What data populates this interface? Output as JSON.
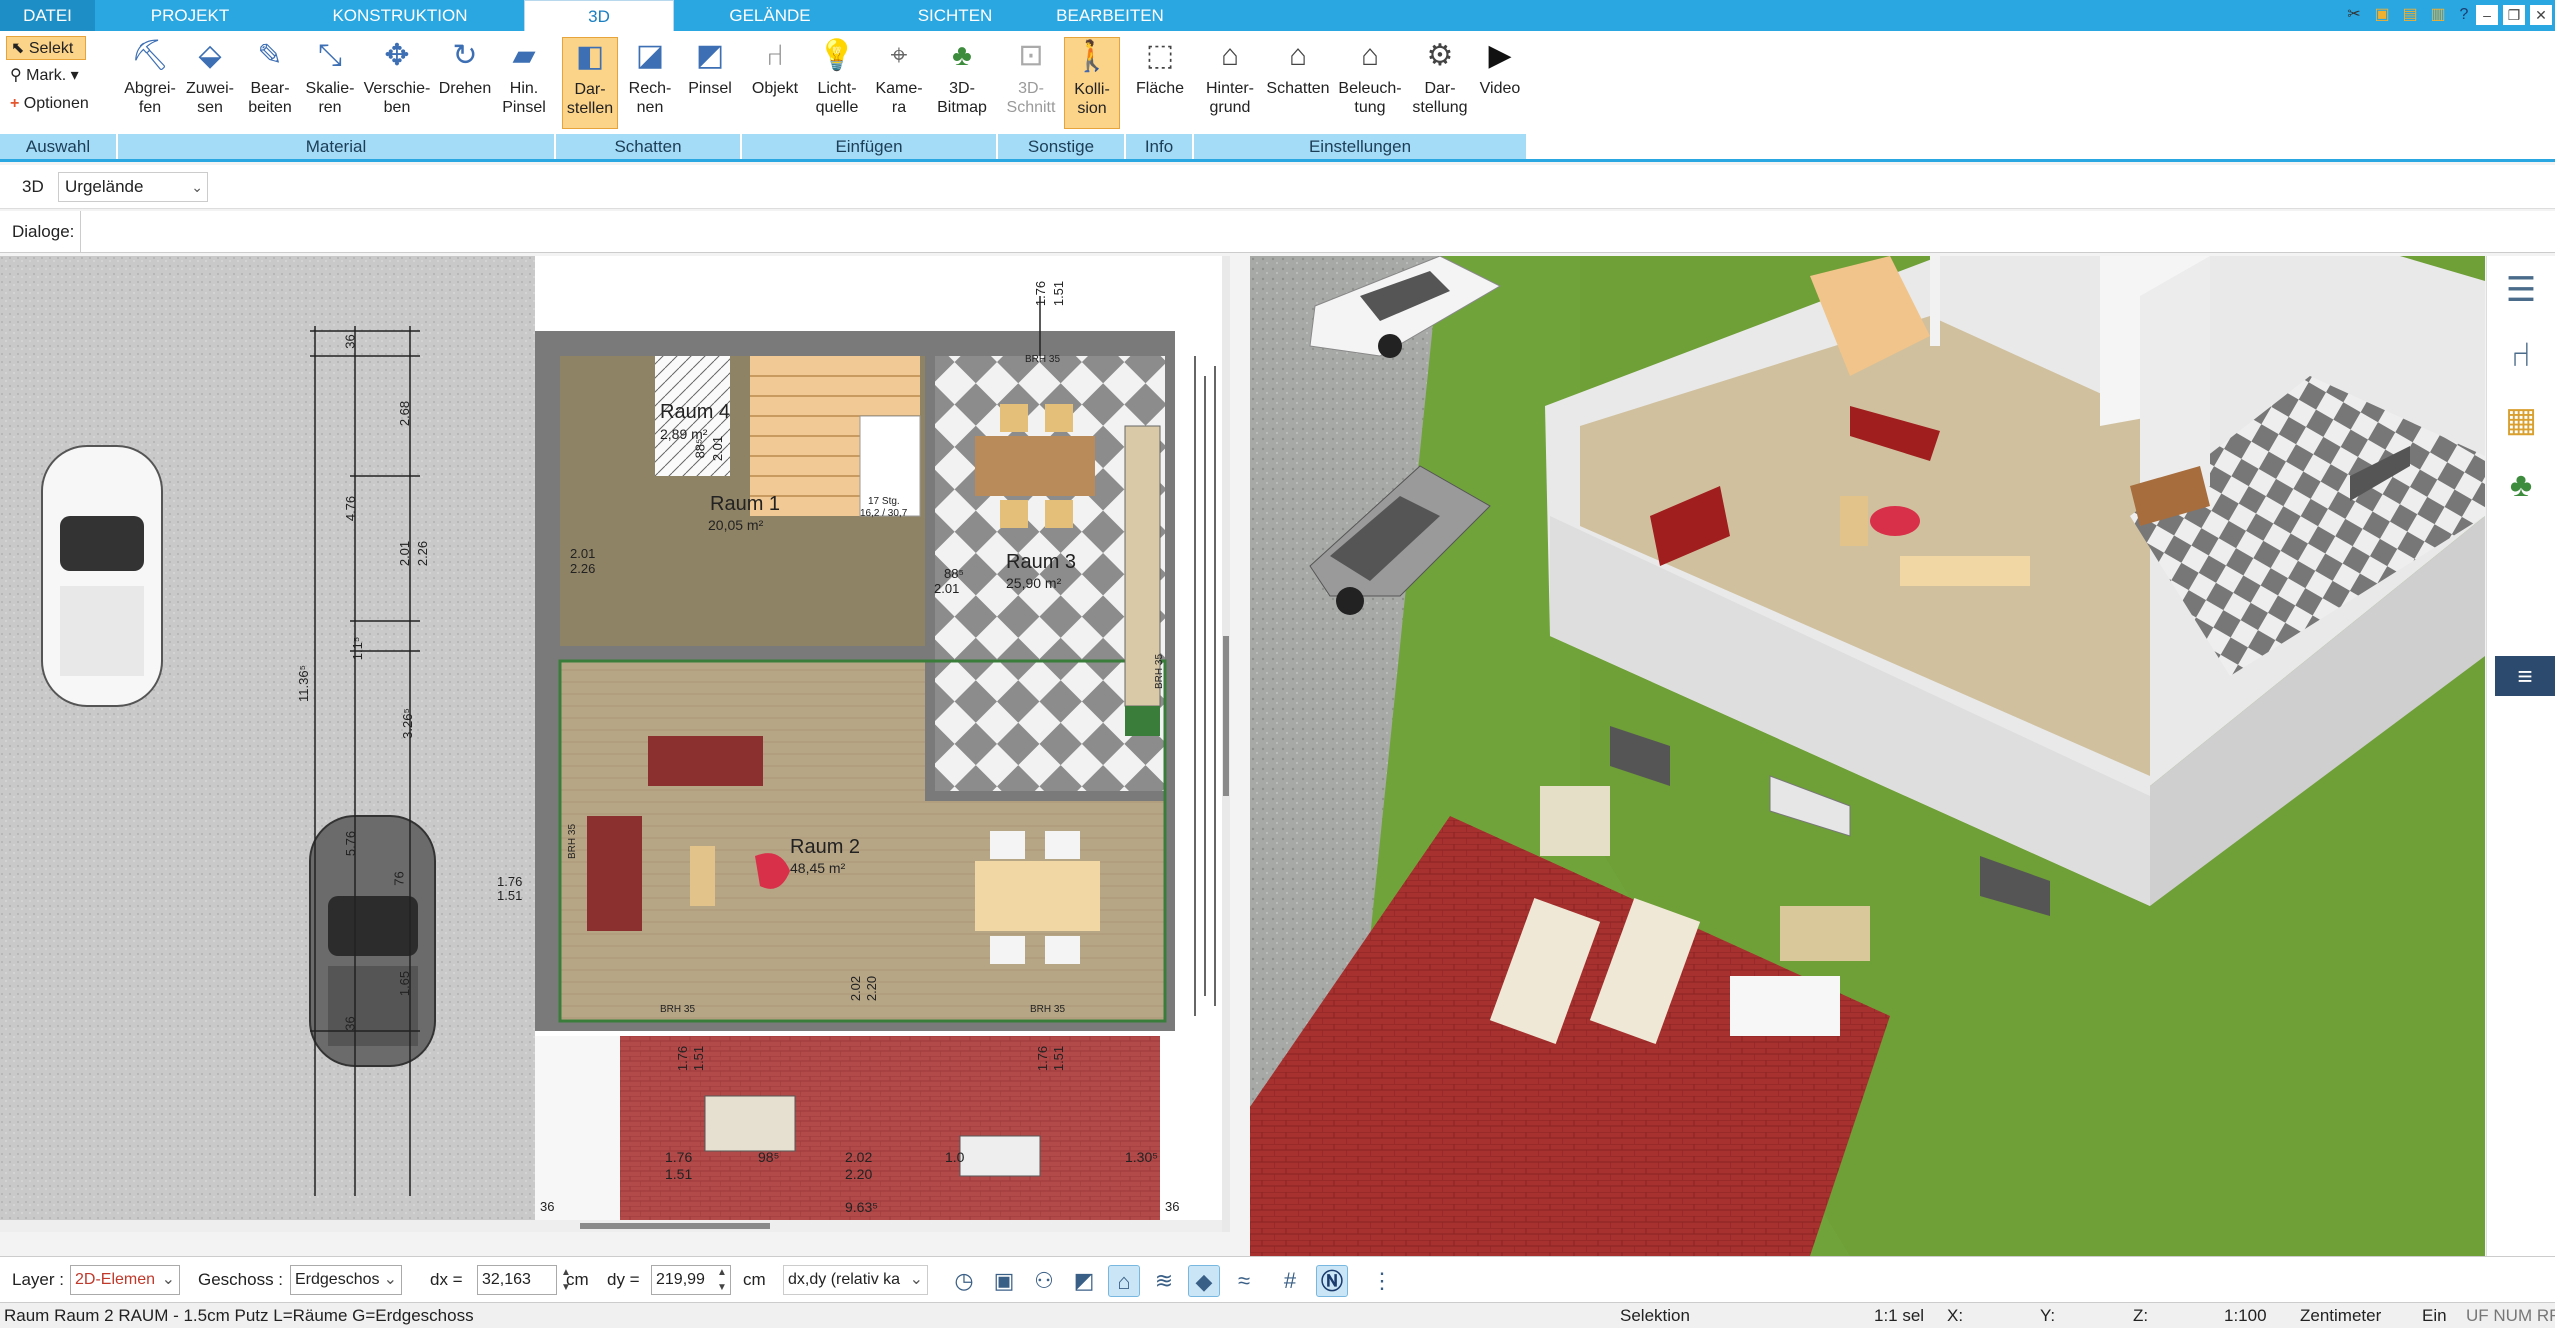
{
  "tabs": [
    "DATEI",
    "PROJEKT",
    "KONSTRUKTION",
    "3D",
    "GELÄNDE",
    "SICHTEN",
    "BEARBEITEN"
  ],
  "active_tab": "3D",
  "ribbon": {
    "auswahl": {
      "label": "Auswahl",
      "selekt": "Selekt",
      "mark": "Mark.",
      "optionen": "Optionen"
    },
    "material": {
      "label": "Material",
      "buttons": [
        "Abgrei-\nfen",
        "Zuwei-\nsen",
        "Bear-\nbeiten",
        "Skalie-\nren",
        "Verschie-\nben",
        "Drehen",
        "Hin.\nPinsel"
      ]
    },
    "schatten": {
      "label": "Schatten",
      "buttons": [
        "Dar-\nstellen",
        "Rech-\nnen",
        "Pinsel"
      ]
    },
    "einfuegen": {
      "label": "Einfügen",
      "buttons": [
        "Objekt",
        "Licht-\nquelle",
        "Kame-\nra",
        "3D-\nBitmap"
      ]
    },
    "sonstige": {
      "label": "Sonstige",
      "buttons": [
        "3D-\nSchnitt",
        "Kolli-\nsion"
      ]
    },
    "info": {
      "label": "Info",
      "buttons": [
        "Fläche"
      ]
    },
    "einstellungen": {
      "label": "Einstellungen",
      "buttons": [
        "Hinter-\ngrund",
        "Schatten",
        "Beleuch-\ntung",
        "Dar-\nstellung",
        "Video"
      ]
    }
  },
  "viewbar": {
    "mode": "3D",
    "terrain": "Urgelände"
  },
  "dialoge_label": "Dialoge:",
  "plan": {
    "rooms": [
      {
        "name": "Raum 4",
        "area": "2,89 m²"
      },
      {
        "name": "Raum 1",
        "area": "20,05 m²"
      },
      {
        "name": "Raum 3",
        "area": "25,90 m²"
      },
      {
        "name": "Raum 2",
        "area": "48,45 m²"
      }
    ],
    "dims": [
      "1.76",
      "1.51",
      "36",
      "2.68",
      "4.76",
      "2.01",
      "2.26",
      "11.36⁵",
      "1.1⁵",
      "3.26⁵",
      "5.76",
      "76",
      "1.65",
      "36",
      "2.01",
      "2.26",
      "88⁵",
      "2.01",
      "88⁵",
      "2.01",
      "17 Stg.",
      "16,2 / 30,7",
      "BRH 35",
      "BRH 35",
      "BRH 35",
      "BRH 35",
      "BRH 35",
      "1.76",
      "1.51",
      "2.02",
      "2.20",
      "1.76",
      "1.51",
      "98⁵",
      "2.02",
      "2.20",
      "1.0",
      "1.30⁵",
      "9.63⁵",
      "36",
      "36",
      "1.76",
      "1.51",
      "1.76",
      "1.51"
    ]
  },
  "bottombar": {
    "layer_label": "Layer :",
    "layer_value": "2D-Elemen",
    "geschoss_label": "Geschoss :",
    "geschoss_value": "Erdgeschos",
    "dx_label": "dx =",
    "dx_value": "32,163",
    "dx_unit": "cm",
    "dy_label": "dy =",
    "dy_value": "219,99",
    "dy_unit": "cm",
    "mode_value": "dx,dy (relativ ka"
  },
  "statusbar": {
    "info": "Raum Raum 2 RAUM - 1.5cm Putz L=Räume G=Erdgeschoss",
    "mode": "Selektion",
    "scale_sel": "1:1 sel",
    "x": "X:",
    "y": "Y:",
    "z": "Z:",
    "scale": "1:100",
    "unit": "Zentimeter",
    "ein": "Ein",
    "flags": "UF NUM RF"
  },
  "colors": {
    "accent": "#2aa6e0",
    "group_label": "#a4dbf7",
    "active_button": "#fbd48a",
    "terrace": "#b03a3a",
    "floor": "#b9a88a",
    "wall": "#e9e9e9"
  }
}
